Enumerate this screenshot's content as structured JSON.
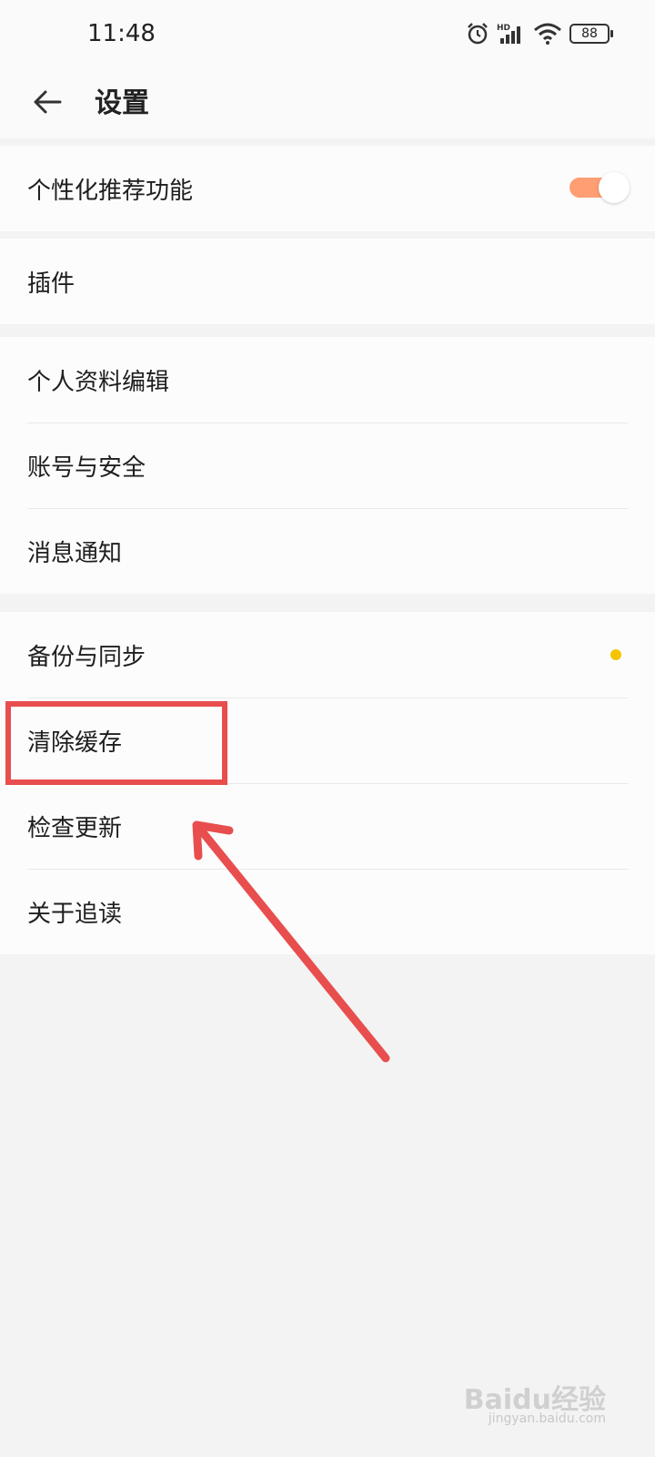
{
  "status_bar": {
    "time": "11:48",
    "battery": "88",
    "icons": [
      "alarm-icon",
      "hd-signal-icon",
      "wifi-icon",
      "battery-icon"
    ]
  },
  "header": {
    "title": "设置",
    "back_icon": "back-arrow-icon"
  },
  "groups": [
    {
      "items": [
        {
          "label": "个性化推荐功能",
          "toggle_on": true
        }
      ]
    },
    {
      "items": [
        {
          "label": "插件"
        }
      ]
    },
    {
      "items": [
        {
          "label": "个人资料编辑"
        },
        {
          "label": "账号与安全"
        },
        {
          "label": "消息通知"
        }
      ]
    },
    {
      "items": [
        {
          "label": "备份与同步",
          "badge": "dot"
        },
        {
          "label": "清除缓存"
        },
        {
          "label": "检查更新"
        },
        {
          "label": "关于追读"
        }
      ]
    }
  ],
  "annotation": {
    "color": "#e84e4e"
  },
  "watermark": {
    "brand": "Baidu经验",
    "url": "jingyan.baidu.com"
  },
  "colors": {
    "toggle_on": "#ff9e72",
    "badge_dot": "#f4c400",
    "background": "#f3f3f3",
    "card": "#fcfcfc"
  }
}
